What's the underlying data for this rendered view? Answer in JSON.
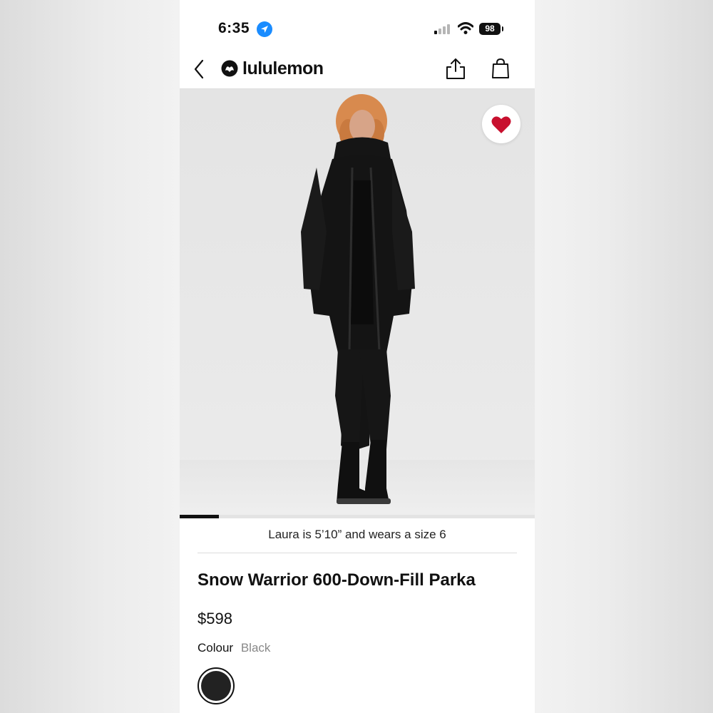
{
  "status_bar": {
    "time": "6:35",
    "battery": "98",
    "icons": [
      "location-arrow-icon",
      "cellular-signal-icon",
      "wifi-icon",
      "battery-icon"
    ]
  },
  "nav": {
    "brand": "lululemon",
    "icons": [
      "back-chevron-icon",
      "lululemon-logo-icon",
      "share-icon",
      "shopping-bag-icon"
    ]
  },
  "product": {
    "image_icons": [
      "heart-icon"
    ],
    "favorite_color": "#c8102e",
    "carousel": {
      "current": 1,
      "total": 9
    },
    "fit_note": "Laura is 5’10” and wears a size 6",
    "name": "Snow Warrior 600-Down-Fill Parka",
    "price": "$598",
    "colour_label": "Colour",
    "colour_value": "Black",
    "swatch_color": "#222222"
  }
}
